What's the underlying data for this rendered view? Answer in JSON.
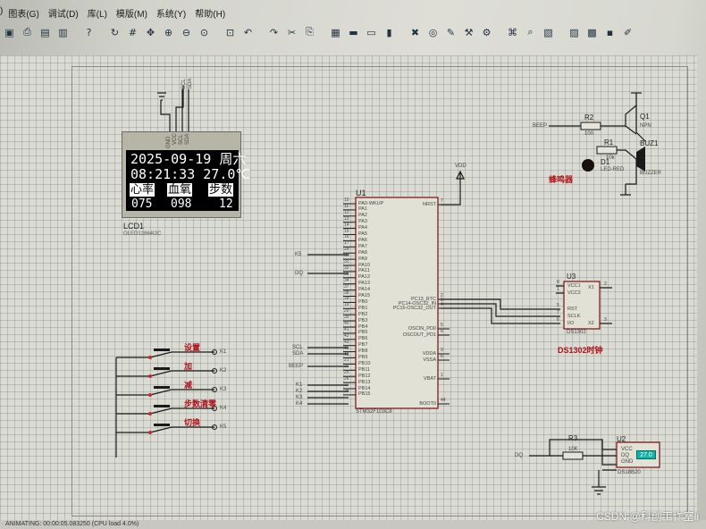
{
  "menu": [
    ")",
    "图表(G)",
    "调试(D)",
    "库(L)",
    "模版(M)",
    "系统(Y)",
    "帮助(H)"
  ],
  "toolbar": {
    "icons": [
      "save-icon",
      "print-icon",
      "image-icon",
      "doc-icon",
      "help-icon",
      "refresh-icon",
      "grid-icon",
      "pan-icon",
      "zoom-in-icon",
      "zoom-out-icon",
      "zoom-all-icon",
      "zoom-area-icon",
      "undo-icon",
      "redo-icon",
      "cut-icon",
      "copy-icon",
      "paste-icon",
      "block-copy-icon",
      "block-move-icon",
      "block-rotate-icon",
      "block-delete-icon",
      "pick-device-icon",
      "make-device-icon",
      "packaging-icon",
      "decompose-icon",
      "wire-autoroute-icon",
      "search-icon",
      "property-icon",
      "netlist-icon",
      "bom-icon",
      "erc-icon",
      "edit-icon"
    ]
  },
  "oled": {
    "pins": [
      "GND",
      "VCC",
      "SCL",
      "SDA"
    ],
    "top_pins": [
      "SCL",
      "SDA"
    ],
    "line1": "2025-09-19 周六",
    "line2": "08:21:33  27.0℃",
    "tabs": [
      "心率",
      "血氧",
      "步数"
    ],
    "values": [
      "075",
      "098",
      "12"
    ],
    "ref": "LCD1",
    "part": "OLED12864I2C"
  },
  "mcu": {
    "ref": "U1",
    "part": "STM32F103C8",
    "left_pins": [
      {
        "num": "10",
        "name": "PA0-WKUP"
      },
      {
        "num": "11",
        "name": "PA1"
      },
      {
        "num": "12",
        "name": "PA2"
      },
      {
        "num": "13",
        "name": "PA3"
      },
      {
        "num": "14",
        "name": "PA4"
      },
      {
        "num": "15",
        "name": "PA5"
      },
      {
        "num": "16",
        "name": "PA6"
      },
      {
        "num": "17",
        "name": "PA7"
      },
      {
        "num": "29",
        "name": "PA8"
      },
      {
        "num": "30",
        "name": "PA9"
      },
      {
        "num": "31",
        "name": "PA10"
      },
      {
        "num": "32",
        "name": "PA11"
      },
      {
        "num": "33",
        "name": "PA12"
      },
      {
        "num": "34",
        "name": "PA13"
      },
      {
        "num": "37",
        "name": "PA14"
      },
      {
        "num": "38",
        "name": "PA15"
      },
      {
        "num": "18",
        "name": "PB0"
      },
      {
        "num": "19",
        "name": "PB1"
      },
      {
        "num": "20",
        "name": "PB2"
      },
      {
        "num": "39",
        "name": "PB3"
      },
      {
        "num": "40",
        "name": "PB4"
      },
      {
        "num": "41",
        "name": "PB5"
      },
      {
        "num": "42",
        "name": "PB6"
      },
      {
        "num": "43",
        "name": "PB7"
      },
      {
        "num": "45",
        "name": "PB8"
      },
      {
        "num": "46",
        "name": "PB9"
      },
      {
        "num": "21",
        "name": "PB10"
      },
      {
        "num": "22",
        "name": "PB11"
      },
      {
        "num": "25",
        "name": "PB12"
      },
      {
        "num": "26",
        "name": "PB13"
      },
      {
        "num": "27",
        "name": "PB14"
      },
      {
        "num": "28",
        "name": "PB15"
      }
    ],
    "right_pins": [
      "NRST",
      "PC13_RTC",
      "PC14-OSC32_IN",
      "PC15-OSC32_OUT",
      "OSCIN_PD0",
      "OSCOUT_PD1",
      "VDDA",
      "VSSA",
      "VBAT",
      "BOOT0"
    ],
    "right_nums": [
      "7",
      "2",
      "3",
      "4",
      "5",
      "6",
      "9",
      "8",
      "1",
      "44"
    ]
  },
  "nets": {
    "k5": "K5",
    "dq": "DQ",
    "scl": "SCL",
    "sda": "SDA",
    "beep": "BEEP",
    "k1": "K1",
    "k2": "K2",
    "k3": "K3",
    "k4": "K4",
    "vdd": "VDD"
  },
  "buttons": [
    {
      "label": "设置",
      "net": "K1"
    },
    {
      "label": "加",
      "net": "K2"
    },
    {
      "label": "减",
      "net": "K3"
    },
    {
      "label": "步数清零",
      "net": "K4"
    },
    {
      "label": "切换",
      "net": "K5"
    }
  ],
  "buzzer": {
    "beep": "BEEP",
    "r2": "R2",
    "r2_val": "100",
    "q1": "Q1",
    "q1_type": "NPN",
    "r1": "R1",
    "r1_val": "10k",
    "d1": "D1",
    "d1_part": "LED-RED",
    "buz": "BUZ1",
    "buz_part": "BUZZER",
    "label": "蜂鸣器"
  },
  "rtc": {
    "ref": "U3",
    "part": "DS1302",
    "left_pins": [
      "VCC1",
      "VCC2",
      "RST",
      "SCLK",
      "I/O"
    ],
    "left_nums": [
      "8",
      "1",
      "5",
      "7",
      "6"
    ],
    "right_pins": [
      "X1",
      "X2"
    ],
    "right_nums": [
      "2",
      "3"
    ],
    "label": "DS1302时钟"
  },
  "temp": {
    "ref": "U2",
    "part": "DS18B20",
    "pins": [
      "VCC",
      "DQ",
      "GND"
    ],
    "r3": "R3",
    "r3_val": "10K",
    "dq": "DQ",
    "reading": "27.0"
  },
  "status": "ANIMATING: 00:00:05.083250 (CPU load 4.0%)",
  "watermark": "CSDN @科创工作室li"
}
